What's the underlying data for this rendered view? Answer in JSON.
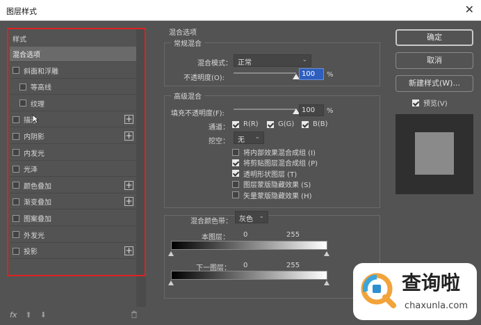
{
  "window": {
    "title": "图层样式",
    "close_glyph": "✕"
  },
  "left_panel": {
    "header": "样式",
    "items": [
      {
        "label": "混合选项",
        "checkbox": false,
        "selected": true,
        "plus": false
      },
      {
        "label": "斜面和浮雕",
        "checkbox": true,
        "checked": false,
        "plus": false
      },
      {
        "label": "等高线",
        "checkbox": true,
        "checked": false,
        "plus": false,
        "indent": true
      },
      {
        "label": "纹理",
        "checkbox": true,
        "checked": false,
        "plus": false,
        "indent": true
      },
      {
        "label": "描边",
        "checkbox": true,
        "checked": false,
        "plus": true
      },
      {
        "label": "内阴影",
        "checkbox": true,
        "checked": false,
        "plus": true
      },
      {
        "label": "内发光",
        "checkbox": true,
        "checked": false,
        "plus": false
      },
      {
        "label": "光泽",
        "checkbox": true,
        "checked": false,
        "plus": false
      },
      {
        "label": "颜色叠加",
        "checkbox": true,
        "checked": false,
        "plus": true
      },
      {
        "label": "渐变叠加",
        "checkbox": true,
        "checked": false,
        "plus": true
      },
      {
        "label": "图案叠加",
        "checkbox": true,
        "checked": false,
        "plus": false
      },
      {
        "label": "外发光",
        "checkbox": true,
        "checked": false,
        "plus": false
      },
      {
        "label": "投影",
        "checkbox": true,
        "checked": false,
        "plus": true
      }
    ],
    "plus_glyph": "+",
    "footer": {
      "fx": "fx",
      "up": "⬆",
      "down": "⬇",
      "trash": "🗑"
    }
  },
  "blend": {
    "section_title": "混合选项",
    "general": {
      "legend": "常规混合",
      "mode_label": "混合模式：",
      "mode_value": "正常",
      "opacity_label": "不透明度(O):",
      "opacity_value": "100",
      "opacity_unit": "%",
      "opacity_level_percent": 100
    },
    "advanced": {
      "legend": "高级混合",
      "fill_label": "填充不透明度(F):",
      "fill_value": "100",
      "fill_unit": "%",
      "fill_level_percent": 100,
      "channels_label": "通道：",
      "channels": [
        {
          "label": "R(R)",
          "checked": true
        },
        {
          "label": "G(G)",
          "checked": true
        },
        {
          "label": "B(B)",
          "checked": true
        }
      ],
      "knockout_label": "挖空：",
      "knockout_value": "无",
      "options": [
        {
          "label": "将内部效果混合成组 (I)",
          "checked": false
        },
        {
          "label": "将剪贴图层混合成组 (P)",
          "checked": true
        },
        {
          "label": "透明形状图层 (T)",
          "checked": true
        },
        {
          "label": "图层蒙版隐藏效果 (S)",
          "checked": false
        },
        {
          "label": "矢量蒙版隐藏效果 (H)",
          "checked": false
        }
      ]
    },
    "blend_if": {
      "label": "混合颜色带：",
      "value": "灰色",
      "this_layer": {
        "label": "本图层：",
        "min": "0",
        "max": "255"
      },
      "underlying": {
        "label": "下一图层：",
        "min": "0",
        "max": "255"
      }
    }
  },
  "buttons": {
    "ok": "确定",
    "cancel": "取消",
    "new_style": "新建样式(W)...",
    "preview_label": "预览(V)",
    "preview_checked": true
  },
  "watermark": {
    "text": "查询啦",
    "url": "chaxunla.com"
  },
  "icons": {
    "dropdown": "chevron-down-icon",
    "check": "checkmark-icon",
    "plus": "plus-icon",
    "close": "close-icon"
  },
  "colors": {
    "accent": "#2e5fbf",
    "highlight_border": "#e02222",
    "background": "#535353"
  }
}
